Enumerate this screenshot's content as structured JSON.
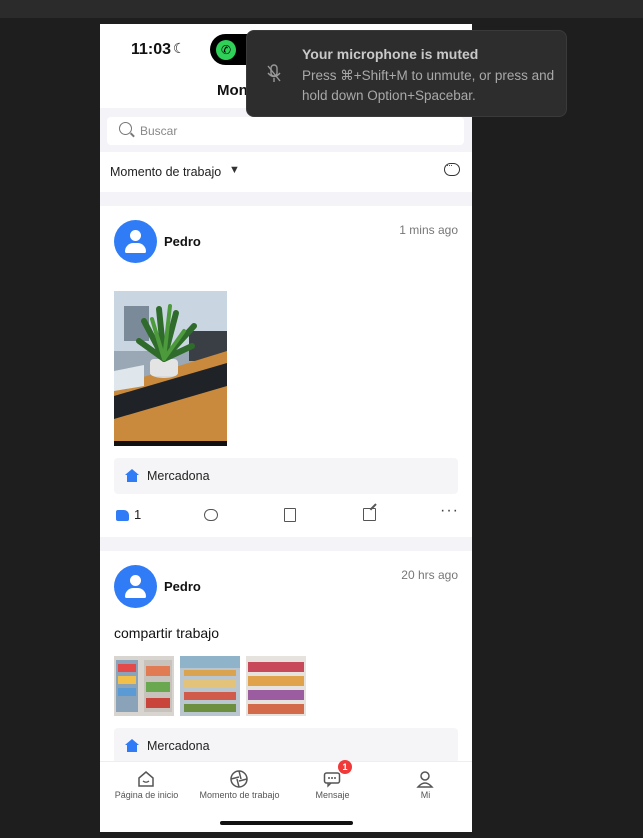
{
  "status_bar": {
    "time": "11:03"
  },
  "nav": {
    "title": "Mon"
  },
  "search": {
    "placeholder": "Buscar"
  },
  "filter": {
    "label": "Momento de trabajo"
  },
  "posts": [
    {
      "user": "Pedro",
      "time_ago": "1 mins ago",
      "text": "",
      "location": "Mercadona",
      "like_count": "1"
    },
    {
      "user": "Pedro",
      "time_ago": "20 hrs ago",
      "text": "compartir trabajo",
      "location": "Mercadona"
    }
  ],
  "tabs": [
    {
      "label": "Página de inicio",
      "icon": "home-icon"
    },
    {
      "label": "Momento de trabajo",
      "icon": "aperture-icon"
    },
    {
      "label": "Mensaje",
      "icon": "message-icon",
      "badge": "1"
    },
    {
      "label": "Mi",
      "icon": "person-icon"
    }
  ],
  "toast": {
    "title": "Your microphone is muted",
    "body": "Press ⌘+Shift+M to unmute, or press and hold down Option+Spacebar."
  },
  "colors": {
    "accent": "#2f7cf6",
    "badge": "#f03a3a"
  }
}
